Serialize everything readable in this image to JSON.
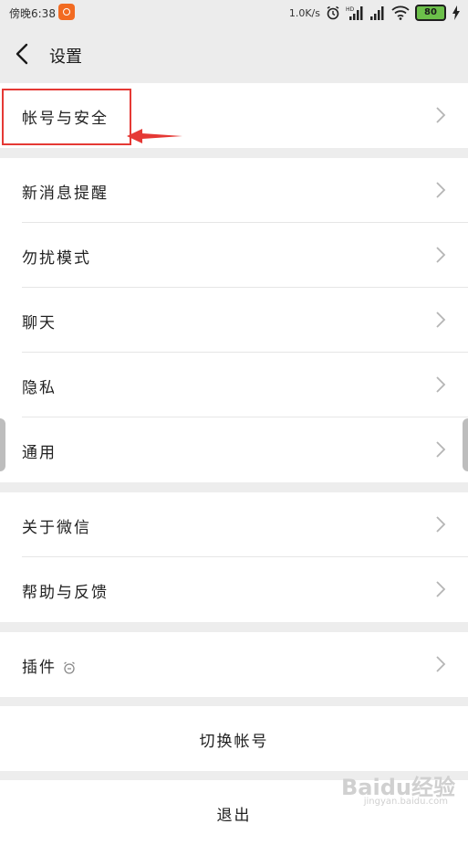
{
  "status_bar": {
    "time": "傍晚6:38",
    "net_speed": "1.0K/s",
    "battery": "80",
    "icons": [
      "app-badge-icon",
      "alarm-icon",
      "hd-signal-icon",
      "signal-icon",
      "wifi-icon",
      "charging-icon"
    ]
  },
  "nav": {
    "title": "设置",
    "back_icon": "back-chevron-icon"
  },
  "groups": [
    {
      "items": [
        {
          "label": "帐号与安全"
        }
      ]
    },
    {
      "items": [
        {
          "label": "新消息提醒"
        },
        {
          "label": "勿扰模式"
        },
        {
          "label": "聊天"
        },
        {
          "label": "隐私"
        },
        {
          "label": "通用"
        }
      ]
    },
    {
      "items": [
        {
          "label": "关于微信"
        },
        {
          "label": "帮助与反馈"
        }
      ]
    },
    {
      "items": [
        {
          "label": "插件"
        }
      ]
    },
    {
      "items": [
        {
          "label": "切换帐号"
        }
      ]
    },
    {
      "items": [
        {
          "label": "退出"
        }
      ]
    }
  ],
  "annotation": {
    "color": "#e53935"
  },
  "watermark": {
    "text": "Baidu经验",
    "sub": "jingyan.baidu.com"
  },
  "colors": {
    "background": "#ededed",
    "card": "#ffffff",
    "battery": "#6cc04a",
    "app_badge": "#f26b22"
  }
}
